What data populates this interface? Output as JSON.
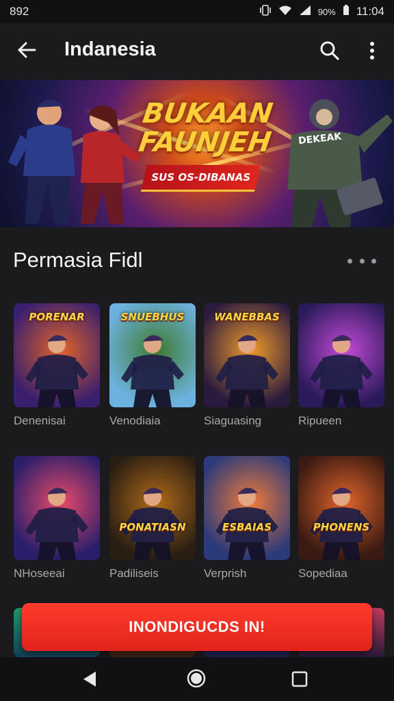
{
  "status_bar": {
    "left_text": "892",
    "battery_text": "90%",
    "time": "11:04",
    "icons": [
      "vibrate-icon",
      "wifi-icon",
      "signal-icon"
    ]
  },
  "app_bar": {
    "title": "Indanesia",
    "icons": [
      "back-arrow-icon",
      "search-icon",
      "more-vert-icon"
    ]
  },
  "banner": {
    "title_line1": "BUKAAN",
    "title_line2": "FAUNJEH",
    "ribbon_text": "SUS OS-DIBANAS",
    "tag_text": "DEKEAK"
  },
  "section": {
    "title": "Permasia Fidl",
    "more_icon": "more-horiz-icon"
  },
  "games": [
    {
      "label": "Denenisai",
      "logo": "PORENAR",
      "bg1": "#3a1f6e",
      "bg2": "#e0622a"
    },
    {
      "label": "Venodiaia",
      "logo": "SNUEBHUS",
      "bg1": "#6cb2e0",
      "bg2": "#3f7a2e"
    },
    {
      "label": "Siaguasing",
      "logo": "WANEBBAS",
      "bg1": "#2a1a3e",
      "bg2": "#f09a2a"
    },
    {
      "label": "Ripueen",
      "logo": "",
      "bg1": "#2b1a5a",
      "bg2": "#c44ad8"
    },
    {
      "label": "NHoseeai",
      "logo": "",
      "bg1": "#2a1e6a",
      "bg2": "#e84a6a"
    },
    {
      "label": "Padiliseis",
      "logo": "PONATIASN",
      "bg1": "#2a1e12",
      "bg2": "#b06a1a"
    },
    {
      "label": "Verprish",
      "logo": "ESBAIAS",
      "bg1": "#2a3a7a",
      "bg2": "#f07a3a"
    },
    {
      "label": "Sopediaa",
      "logo": "PHONENS",
      "bg1": "#3a1a12",
      "bg2": "#e0642a"
    }
  ],
  "cta": {
    "label": "INONDIGUCDS IN!"
  },
  "nav_bar": {
    "icons": [
      "nav-back-icon",
      "nav-home-icon",
      "nav-recents-icon"
    ]
  },
  "colors": {
    "background": "#1b1b1e",
    "cta": "#e82a1f",
    "label_gray": "#a9a9ad"
  }
}
